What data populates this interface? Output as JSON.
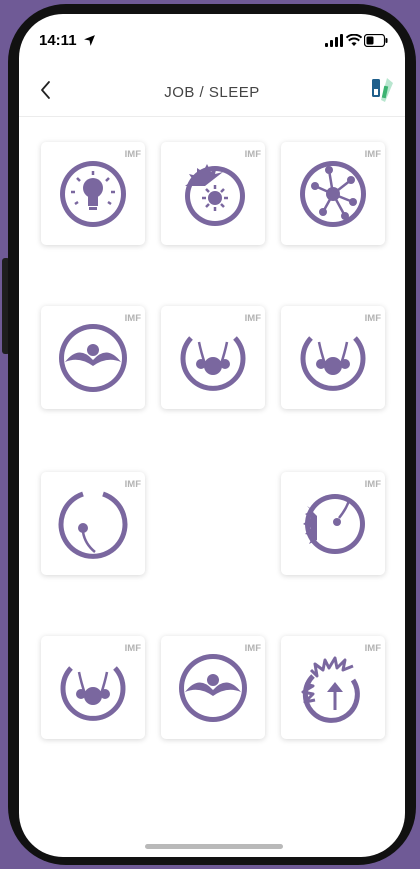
{
  "status_bar": {
    "time": "14:11"
  },
  "header": {
    "title": "JOB / SLEEP"
  },
  "tiles": [
    {
      "badge": "IMF",
      "icon": "lightbulb-icon"
    },
    {
      "badge": "IMF",
      "icon": "sun-flame-icon"
    },
    {
      "badge": "IMF",
      "icon": "network-nodes-icon"
    },
    {
      "badge": "IMF",
      "icon": "mustache-circle-icon"
    },
    {
      "badge": "IMF",
      "icon": "face-arms-icon"
    },
    {
      "badge": "IMF",
      "icon": "face-arms-icon"
    },
    {
      "badge": "IMF",
      "icon": "open-circle-drop-icon"
    },
    {
      "badge": "IMF",
      "icon": "spiky-circle-drop-icon"
    },
    {
      "badge": "IMF",
      "icon": "face-arms-icon"
    },
    {
      "badge": "IMF",
      "icon": "mustache-circle-icon"
    },
    {
      "badge": "IMF",
      "icon": "sun-arrow-icon"
    }
  ],
  "colors": {
    "accent": "#7a679f",
    "background": "#6f5a96"
  }
}
